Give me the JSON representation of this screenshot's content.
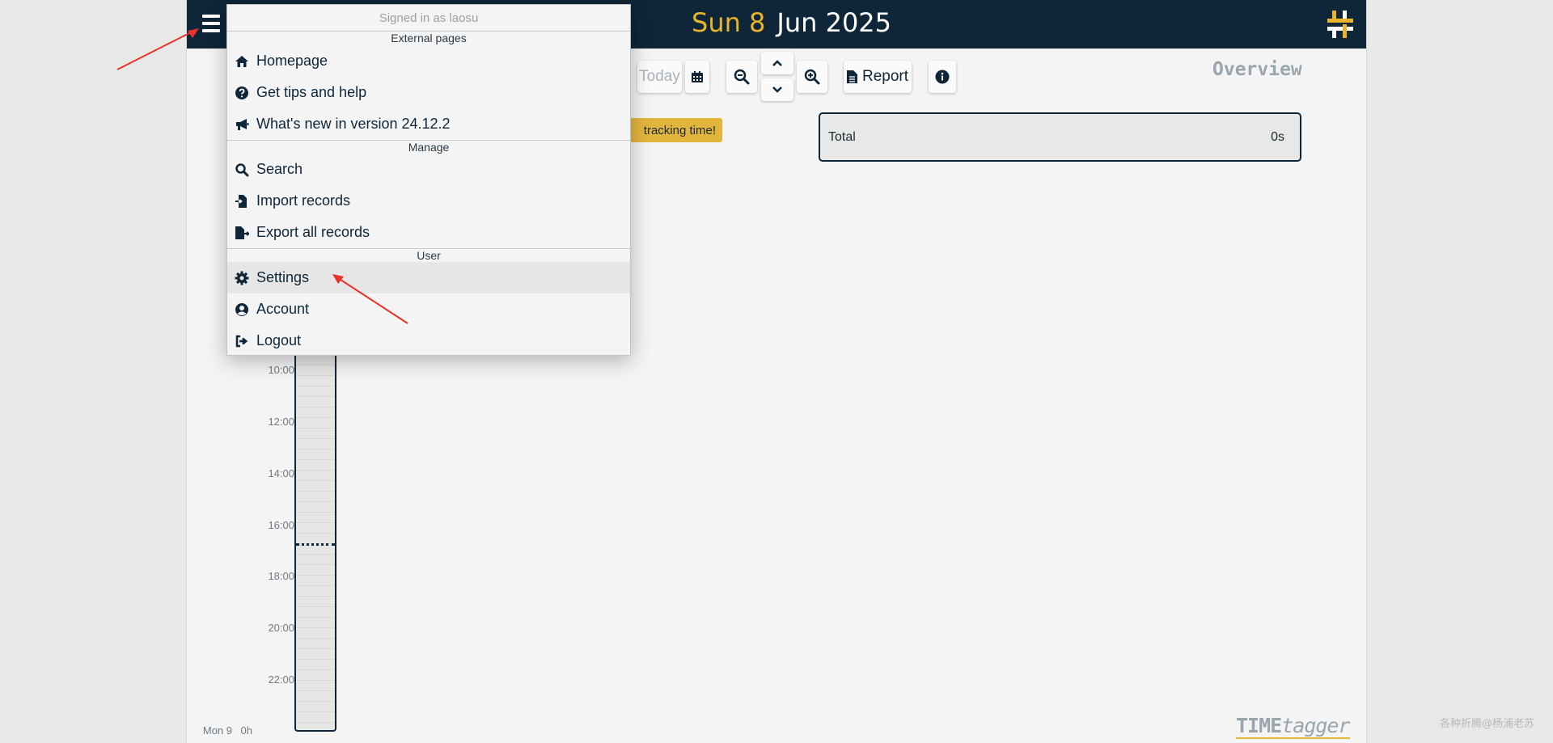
{
  "header": {
    "date_day": "Sun 8",
    "date_rest": "Jun 2025"
  },
  "toolbar": {
    "today_label": "Today",
    "report_label": "Report"
  },
  "overview": {
    "title": "Overview",
    "total_label": "Total",
    "total_value": "0s",
    "tracking_badge": "tracking time!"
  },
  "timeline": {
    "labels": [
      "10:00",
      "12:00",
      "14:00",
      "16:00",
      "18:00",
      "20:00",
      "22:00"
    ],
    "bottom_day": "Mon 9",
    "bottom_total": "0h"
  },
  "menu": {
    "signed_in": "Signed in as laosu",
    "sections": {
      "external": "External pages",
      "manage": "Manage",
      "user": "User"
    },
    "items": {
      "homepage": "Homepage",
      "tips": "Get tips and help",
      "whats_new": "What's new in version 24.12.2",
      "search": "Search",
      "import": "Import records",
      "export": "Export all records",
      "settings": "Settings",
      "account": "Account",
      "logout": "Logout"
    }
  },
  "footer": {
    "logo_time": "TIME",
    "logo_tagger": "tagger",
    "watermark": "各种折腾@杨浦老苏"
  },
  "colors": {
    "topbar": "#0e2638",
    "accent": "#e9b42b",
    "annotation_arrow": "#e8322a"
  }
}
